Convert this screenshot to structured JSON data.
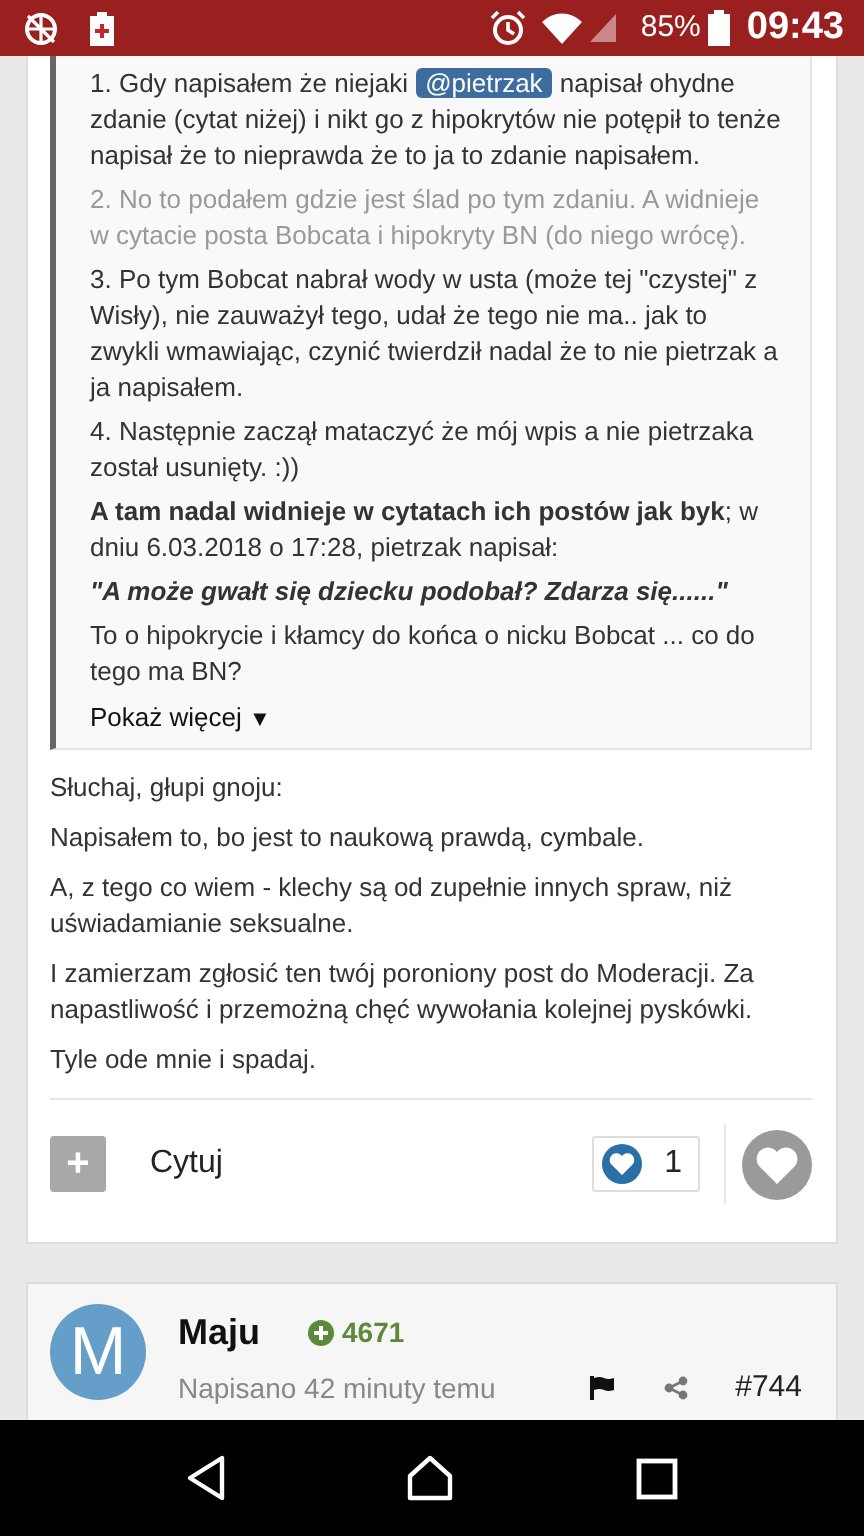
{
  "status_bar": {
    "battery": "85%",
    "time": "09:43"
  },
  "post": {
    "quote": {
      "items": [
        {
          "kind": "mention",
          "before": "1. Gdy napisałem że niejaki",
          "mention": "@pietrzak",
          "after": "napisał ohydne zdanie (cytat niżej) i nikt go z hipokrytów nie potępił to tenże napisał że to nieprawda że to ja to zdanie napisałem."
        },
        {
          "kind": "text",
          "text": "2.  No to podałem gdzie jest ślad po tym zdaniu. A widnieje w cytacie  posta Bobcata i hipokryty BN (do niego wrócę)."
        },
        {
          "kind": "text",
          "text": "3. Po tym Bobcat nabrał wody w usta (może tej \"czystej\" z Wisły), nie zauważył tego, udał że tego nie ma.. jak to zwykli wmawiając, czynić twierdził nadal że to nie pietrzak a ja napisałem."
        },
        {
          "kind": "text",
          "text": "4. Następnie zaczął mataczyć że mój wpis a nie pietrzaka został usunięty.  :))"
        },
        {
          "kind": "text",
          "text": "**A tam nadal widnieje w cytatach ich postów jak byk**; w dniu 6.03.2018 o 17:28, pietrzak napisał:"
        },
        {
          "kind": "quote",
          "text": "**\"A może gwałt się dziecku podobał? Zdarza się......\"**"
        },
        {
          "kind": "text",
          "text": "To o hipokrycie i kłamcy do końca o nicku Bobcat ... co do tego ma BN?"
        }
      ],
      "more": "Pokaż więcej",
      "more_icon": "▼"
    },
    "body": [
      "Słuchaj, głupi gnoju:",
      "Napisałem to, bo jest to naukową prawdą, cymbale.",
      "A, z tego co wiem - klechy są od zupełnie innych spraw, niż uświadamianie seksualne.",
      "I zamierzam zgłosić ten twój poroniony post do Moderacji. Za napastliwość i przemożną chęć wywołania kolejnej pyskówki.",
      "Tyle ode mnie i spadaj."
    ],
    "footer": {
      "plus": "+",
      "quote_label": "Cytuj",
      "reaction_count": "1",
      "liked": false
    }
  },
  "next_post": {
    "avatar_letter": "M",
    "author": "Maju",
    "reputation": "4671",
    "time": "Napisano 42 minuty temu",
    "number": "#744"
  }
}
